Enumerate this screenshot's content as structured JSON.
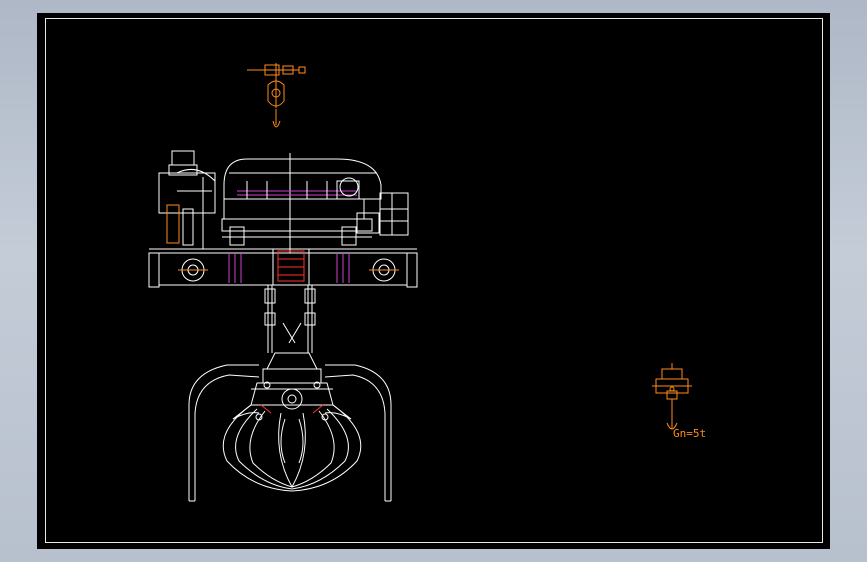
{
  "drawing": {
    "weight_label": "Gn=5t"
  },
  "colors": {
    "background": "#000000",
    "lines": "#ffffff",
    "accent": "#ff8c1a",
    "magenta": "#d040d0",
    "red": "#ff3030",
    "frame_outer": "#b7c0cd"
  }
}
